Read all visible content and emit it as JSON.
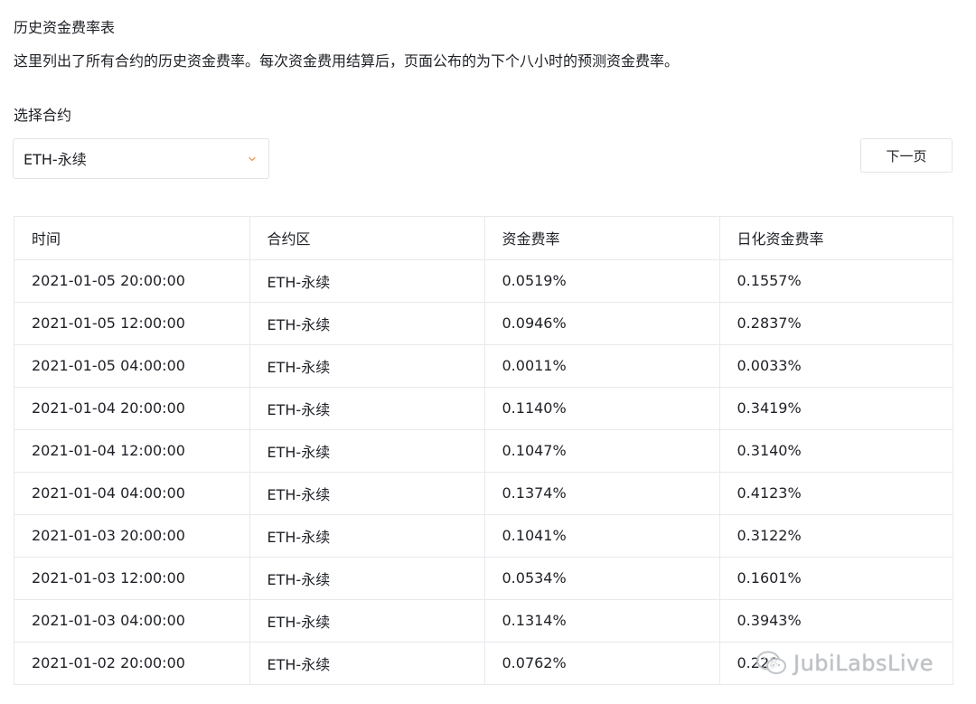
{
  "page": {
    "title": "历史资金费率表",
    "description": "这里列出了所有合约的历史资金费率。每次资金费用结算后，页面公布的为下个八小时的预测资金费率。"
  },
  "contract_select": {
    "label": "选择合约",
    "selected": "ETH-永续",
    "chevron_icon": "chevron-down-icon",
    "chevron_color": "#f0873e"
  },
  "pagination": {
    "next_label": "下一页"
  },
  "table": {
    "columns": [
      "时间",
      "合约区",
      "资金费率",
      "日化资金费率"
    ],
    "rows": [
      [
        "2021-01-05 20:00:00",
        "ETH-永续",
        "0.0519%",
        "0.1557%"
      ],
      [
        "2021-01-05 12:00:00",
        "ETH-永续",
        "0.0946%",
        "0.2837%"
      ],
      [
        "2021-01-05 04:00:00",
        "ETH-永续",
        "0.0011%",
        "0.0033%"
      ],
      [
        "2021-01-04 20:00:00",
        "ETH-永续",
        "0.1140%",
        "0.3419%"
      ],
      [
        "2021-01-04 12:00:00",
        "ETH-永续",
        "0.1047%",
        "0.3140%"
      ],
      [
        "2021-01-04 04:00:00",
        "ETH-永续",
        "0.1374%",
        "0.4123%"
      ],
      [
        "2021-01-03 20:00:00",
        "ETH-永续",
        "0.1041%",
        "0.3122%"
      ],
      [
        "2021-01-03 12:00:00",
        "ETH-永续",
        "0.0534%",
        "0.1601%"
      ],
      [
        "2021-01-03 04:00:00",
        "ETH-永续",
        "0.1314%",
        "0.3943%"
      ],
      [
        "2021-01-02 20:00:00",
        "ETH-永续",
        "0.0762%",
        "0.228"
      ]
    ]
  },
  "watermark": {
    "text": "JubiLabsLive",
    "icon": "wechat-icon"
  }
}
